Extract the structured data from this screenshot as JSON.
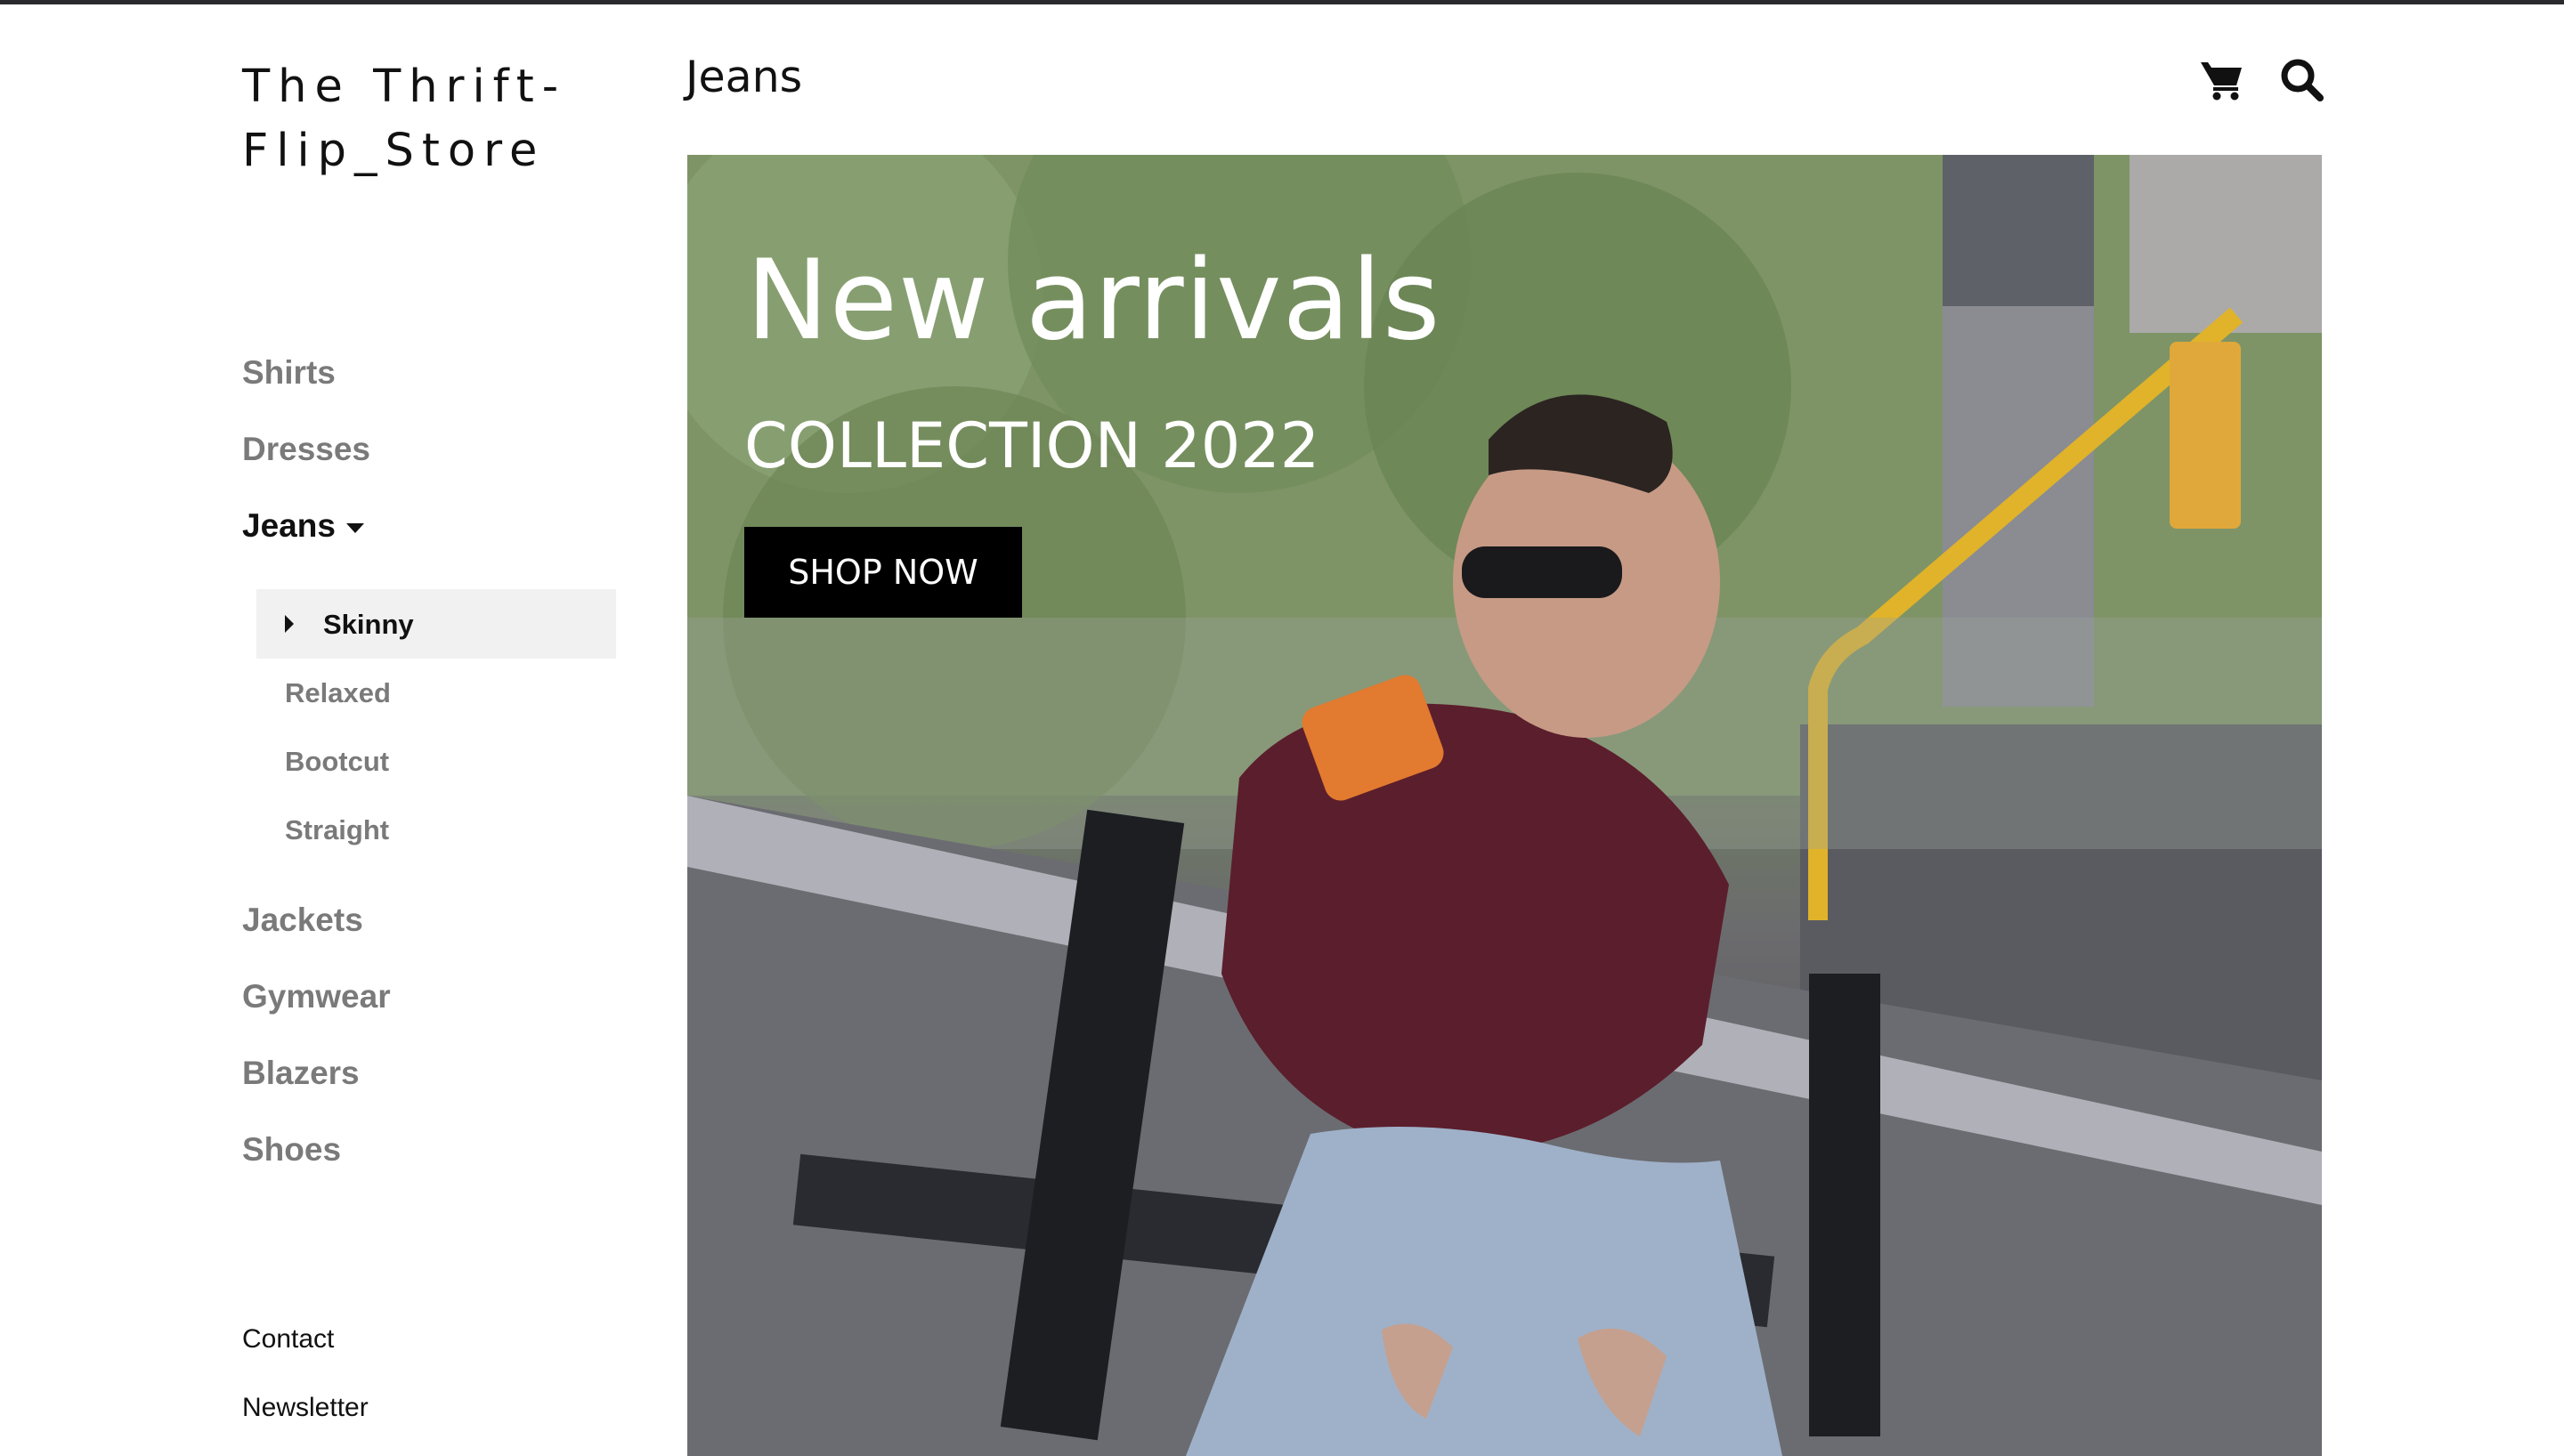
{
  "brand": {
    "line1": "The Thrift-",
    "line2": "Flip_Store"
  },
  "header": {
    "title": "Jeans",
    "cart_icon": "cart-icon",
    "search_icon": "search-icon"
  },
  "sidebar": {
    "items": [
      {
        "label": "Shirts"
      },
      {
        "label": "Dresses"
      },
      {
        "label": "Jeans",
        "expanded": true
      },
      {
        "label": "Jackets"
      },
      {
        "label": "Gymwear"
      },
      {
        "label": "Blazers"
      },
      {
        "label": "Shoes"
      }
    ],
    "subitems": [
      {
        "label": "Skinny",
        "selected": true
      },
      {
        "label": "Relaxed"
      },
      {
        "label": "Bootcut"
      },
      {
        "label": "Straight"
      }
    ],
    "footer": [
      {
        "label": "Contact"
      },
      {
        "label": "Newsletter"
      }
    ]
  },
  "hero": {
    "title": "New arrivals",
    "subtitle": "COLLECTION 2022",
    "button": "SHOP NOW"
  },
  "colors": {
    "accent": "#000000",
    "muted_text": "#7a7a7a",
    "active_text": "#111111",
    "selected_bg": "#f1f1f1"
  }
}
